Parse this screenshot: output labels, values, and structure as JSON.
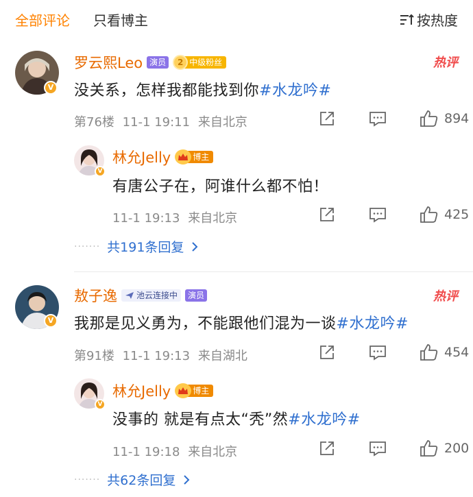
{
  "tabs": {
    "all": "全部评论",
    "author_only": "只看博主",
    "sort": "按热度",
    "sort_icon": "sort-lines-icon"
  },
  "comments": [
    {
      "user": "罗云熙Leo",
      "tag_actor": "演员",
      "fan_level": "2",
      "fan_label": "中级粉丝",
      "hot": "热评",
      "text": "没关系，怎样我都能找到你",
      "hashtag": "#水龙吟#",
      "floor": "第76楼",
      "time": "11-1 19:11",
      "location": "来自北京",
      "likes": "894",
      "reply": {
        "user": "林允Jelly",
        "tag_author": "博主",
        "text": "有唐公子在，阿谁什么都不怕！",
        "time": "11-1 19:13",
        "location": "来自北京",
        "likes": "425"
      },
      "more_replies": "共191条回复"
    },
    {
      "user": "敖子逸",
      "tag_pool": "池云连接中",
      "tag_actor": "演员",
      "hot": "热评",
      "text": "我那是见义勇为，不能跟他们混为一谈",
      "hashtag": "#水龙吟#",
      "floor": "第91楼",
      "time": "11-1 19:13",
      "location": "来自湖北",
      "likes": "454",
      "reply": {
        "user": "林允Jelly",
        "tag_author": "博主",
        "text": "没事的 就是有点太“秃”然",
        "hashtag": "#水龙吟#",
        "time": "11-1 19:18",
        "location": "来自北京",
        "likes": "200"
      },
      "more_replies": "共62条回复"
    }
  ],
  "colors": {
    "accent": "#ff8200",
    "link": "#2f6fcf",
    "username": "#e86a00",
    "hot": "#f04b4b"
  },
  "icons": [
    "share-icon",
    "comment-icon",
    "like-icon",
    "chevron-right-icon",
    "crown-icon",
    "paper-plane-icon"
  ]
}
